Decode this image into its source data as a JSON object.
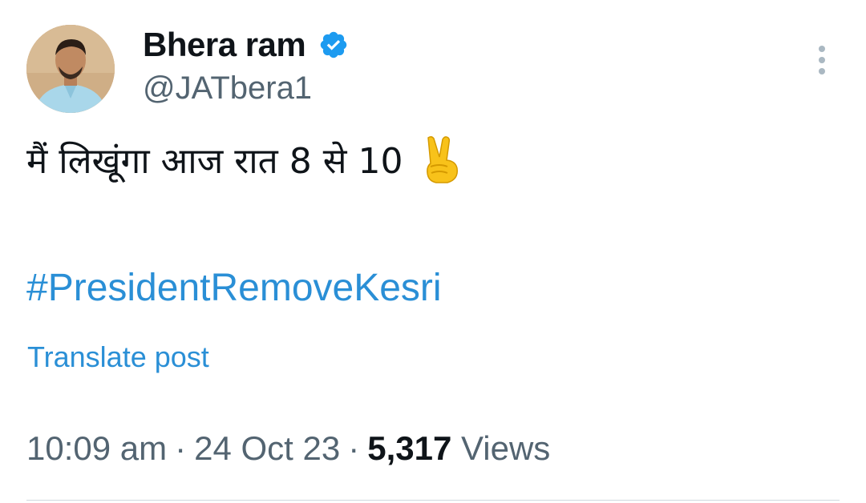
{
  "author": {
    "name": "Bhera ram",
    "handle": "@JATbera1",
    "verified": true
  },
  "tweet": {
    "text": "मैं लिखूंगा आज रात 8 से 10",
    "emoji": "victory-hand-emoji",
    "hashtag": "#PresidentRemoveKesri",
    "translate_label": "Translate post"
  },
  "meta": {
    "time": "10:09 am",
    "separator": "·",
    "date": "24 Oct 23",
    "views_count": "5,317",
    "views_label": "Views"
  },
  "colors": {
    "link": "#2a8fd6",
    "verified_badge": "#1d9bf0",
    "secondary_text": "#536471",
    "primary_text": "#0f1419"
  }
}
